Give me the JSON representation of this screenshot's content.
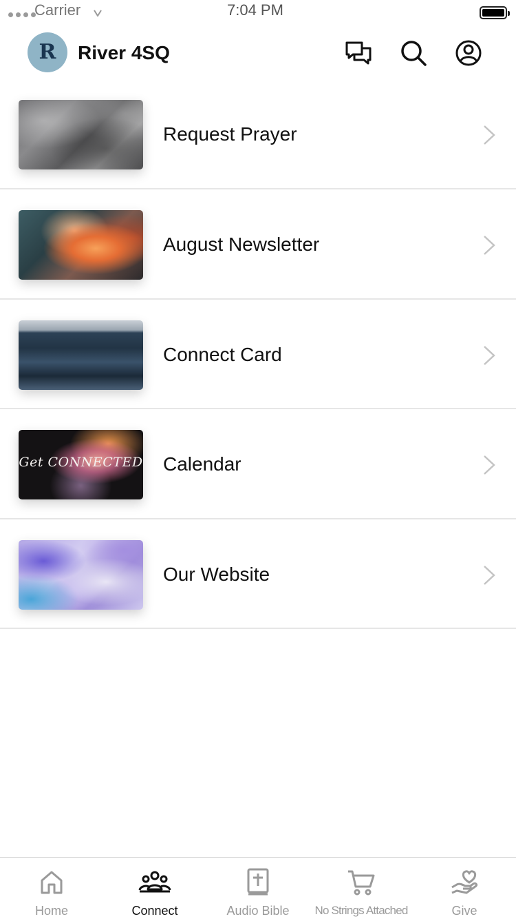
{
  "status_bar": {
    "carrier": "Carrier",
    "time": "7:04 PM"
  },
  "header": {
    "logo_letter": "R",
    "title": "River 4SQ",
    "icons": [
      "chat-icon",
      "search-icon",
      "profile-icon"
    ]
  },
  "list": {
    "items": [
      {
        "label": "Request Prayer",
        "thumbnail": "marble-texture"
      },
      {
        "label": "August Newsletter",
        "thumbnail": "sunset-clouds"
      },
      {
        "label": "Connect Card",
        "thumbnail": "ocean-waves"
      },
      {
        "label": "Calendar",
        "thumbnail": "get-connected-graphic",
        "thumbnail_text": "Get CONNECTED"
      },
      {
        "label": "Our Website",
        "thumbnail": "purple-paint-texture"
      }
    ]
  },
  "tabbar": {
    "active": "Connect",
    "tabs": [
      {
        "label": "Home",
        "icon": "home-icon"
      },
      {
        "label": "Connect",
        "icon": "people-icon"
      },
      {
        "label": "Audio Bible",
        "icon": "bible-icon"
      },
      {
        "label": "No Strings Attached",
        "icon": "cart-icon"
      },
      {
        "label": "Give",
        "icon": "give-heart-icon"
      }
    ]
  },
  "colors": {
    "logo_bg": "#8fb4c6",
    "tab_active": "#111111",
    "tab_inactive": "#9a9a9a",
    "divider": "#e6e6e6"
  }
}
